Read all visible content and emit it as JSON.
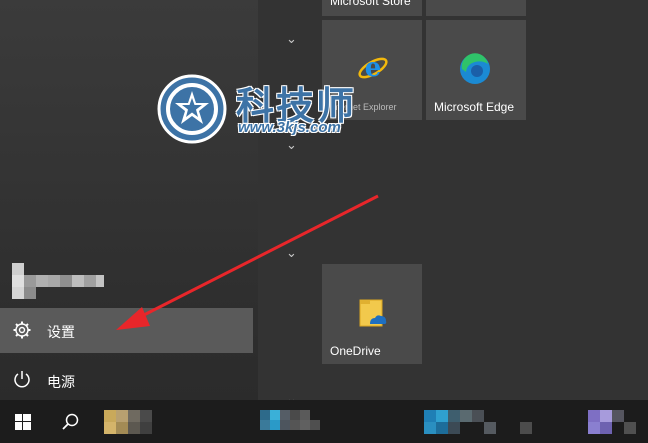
{
  "tiles": {
    "store_label": "Microsoft Store",
    "ie_label": "Internet Explorer",
    "edge_label": "Microsoft Edge",
    "onedrive_label": "OneDrive"
  },
  "menu": {
    "settings_label": "设置",
    "power_label": "电源"
  },
  "watermark": {
    "brand": "科技师",
    "url": "www.3kjs.com"
  },
  "colors": {
    "arrow": "#e8262a",
    "watermark_blue": "#3d73a6"
  }
}
